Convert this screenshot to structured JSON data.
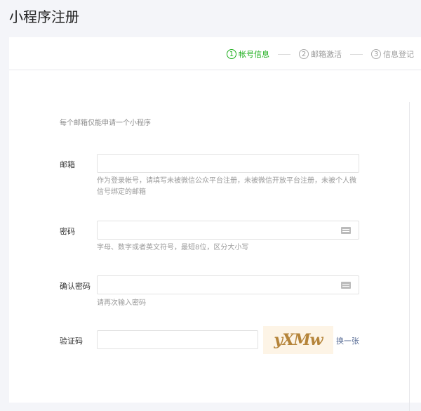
{
  "title": "小程序注册",
  "steps": [
    {
      "num": "1",
      "label": "帐号信息",
      "active": true
    },
    {
      "num": "2",
      "label": "邮箱激活"
    },
    {
      "num": "3",
      "label": "信息登记"
    }
  ],
  "note": "每个邮箱仅能申请一个小程序",
  "form": {
    "email": {
      "label": "邮箱",
      "value": "",
      "hint": "作为登录帐号，请填写未被微信公众平台注册，未被微信开放平台注册，未被个人微信号绑定的邮箱"
    },
    "password": {
      "label": "密码",
      "value": "",
      "hint": "字母、数字或者英文符号，最短8位，区分大小写",
      "icon": "keyboard-icon"
    },
    "confirm": {
      "label": "确认密码",
      "value": "",
      "hint": "请再次输入密码",
      "icon": "keyboard-icon"
    },
    "captcha": {
      "label": "验证码",
      "value": "",
      "image_text": "yXMw",
      "refresh": "换一张"
    }
  },
  "colors": {
    "accent": "#1aad19",
    "link": "#576b95"
  }
}
